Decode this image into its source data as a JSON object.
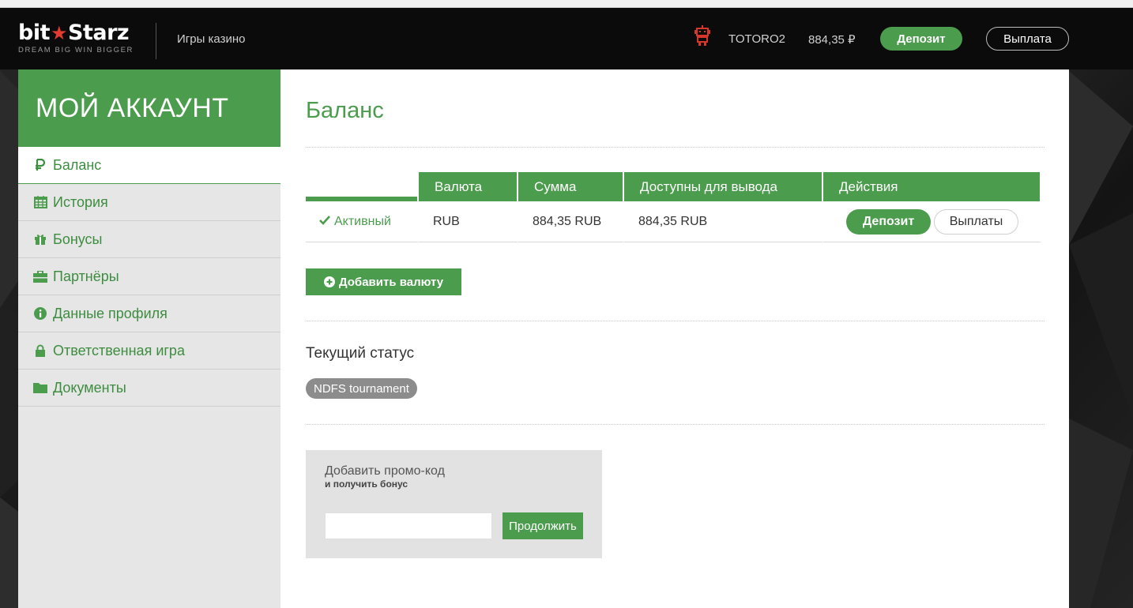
{
  "header": {
    "logo_word_left": "bit",
    "logo_word_right": "Starz",
    "logo_tagline": "DREAM BIG  WIN BIGGER",
    "nav_casino": "Игры казино",
    "username": "TOTORO2",
    "balance": "884,35 ₽",
    "deposit_label": "Депозит",
    "payout_label": "Выплата"
  },
  "sidebar": {
    "title": "МОЙ АККАУНТ",
    "items": [
      {
        "label": "Баланс",
        "icon": "ruble-icon",
        "active": true
      },
      {
        "label": "История",
        "icon": "calendar-icon"
      },
      {
        "label": "Бонусы",
        "icon": "gift-icon"
      },
      {
        "label": "Партнёры",
        "icon": "briefcase-icon"
      },
      {
        "label": "Данные профиля",
        "icon": "info-icon"
      },
      {
        "label": "Ответственная игра",
        "icon": "lock-icon"
      },
      {
        "label": "Документы",
        "icon": "folder-icon"
      }
    ]
  },
  "main": {
    "title": "Баланс",
    "table": {
      "headers": [
        "Валюта",
        "Сумма",
        "Доступны для вывода",
        "Действия"
      ],
      "row": {
        "status": "Активный",
        "currency": "RUB",
        "amount": "884,35 RUB",
        "available": "884,35 RUB",
        "deposit_label": "Депозит",
        "payouts_label": "Выплаты"
      }
    },
    "add_currency_label": "Добавить валюту",
    "status_title": "Текущий статус",
    "status_badge": "NDFS tournament",
    "promo": {
      "title": "Добавить промо-код",
      "subtitle": "и получить бонус",
      "input_value": "",
      "button_label": "Продолжить"
    }
  },
  "colors": {
    "brand_green": "#4c9c4e",
    "logo_star": "#e33b2f",
    "header_bg": "#0b0b0b"
  }
}
